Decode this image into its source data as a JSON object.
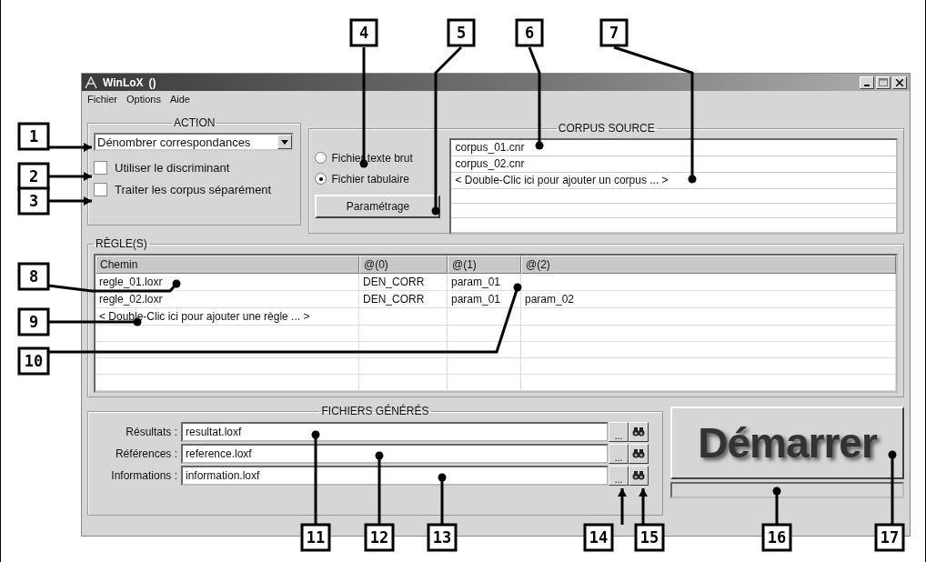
{
  "window": {
    "title": "WinLoX",
    "title_suffix": "()"
  },
  "menu": [
    "Fichier",
    "Options",
    "Aide"
  ],
  "action": {
    "title": "ACTION",
    "dropdown": "Dénombrer correspondances",
    "checkboxes": [
      {
        "label": "Utiliser le discriminant",
        "checked": false
      },
      {
        "label": "Traiter les corpus séparément",
        "checked": false
      }
    ]
  },
  "corpus": {
    "title": "CORPUS SOURCE",
    "formats": [
      {
        "label": "Fichier texte brut",
        "selected": false
      },
      {
        "label": "Fichier tabulaire",
        "selected": true
      }
    ],
    "button": "Paramétrage",
    "items": [
      "corpus_01.cnr",
      "corpus_02.cnr",
      "< Double-Clic ici pour ajouter un corpus ... >"
    ]
  },
  "rules": {
    "title": "RÈGLE(S)",
    "columns": [
      "Chemin",
      "@(0)",
      "@(1)",
      "@(2)"
    ],
    "rows": [
      [
        "regle_01.loxr",
        "DEN_CORR",
        "param_01"
      ],
      [
        "regle_02.loxr",
        "DEN_CORR",
        "param_01",
        "param_02"
      ],
      [
        "< Double-Clic ici pour ajouter une règle ... >"
      ]
    ]
  },
  "outputs": {
    "title": "FICHIERS GÉNÉRÉS",
    "fields": [
      {
        "label": "Résultats :",
        "value": "resultat.loxf",
        "browse": "..."
      },
      {
        "label": "Références :",
        "value": "reference.loxf",
        "browse": "..."
      },
      {
        "label": "Informations :",
        "value": "information.loxf",
        "browse": "..."
      }
    ]
  },
  "start_button": "Démarrer",
  "progress": {
    "level": 0
  },
  "callouts": [
    "1",
    "2",
    "3",
    "4",
    "5",
    "6",
    "7",
    "8",
    "9",
    "10",
    "11",
    "12",
    "13",
    "14",
    "15",
    "16",
    "17"
  ]
}
